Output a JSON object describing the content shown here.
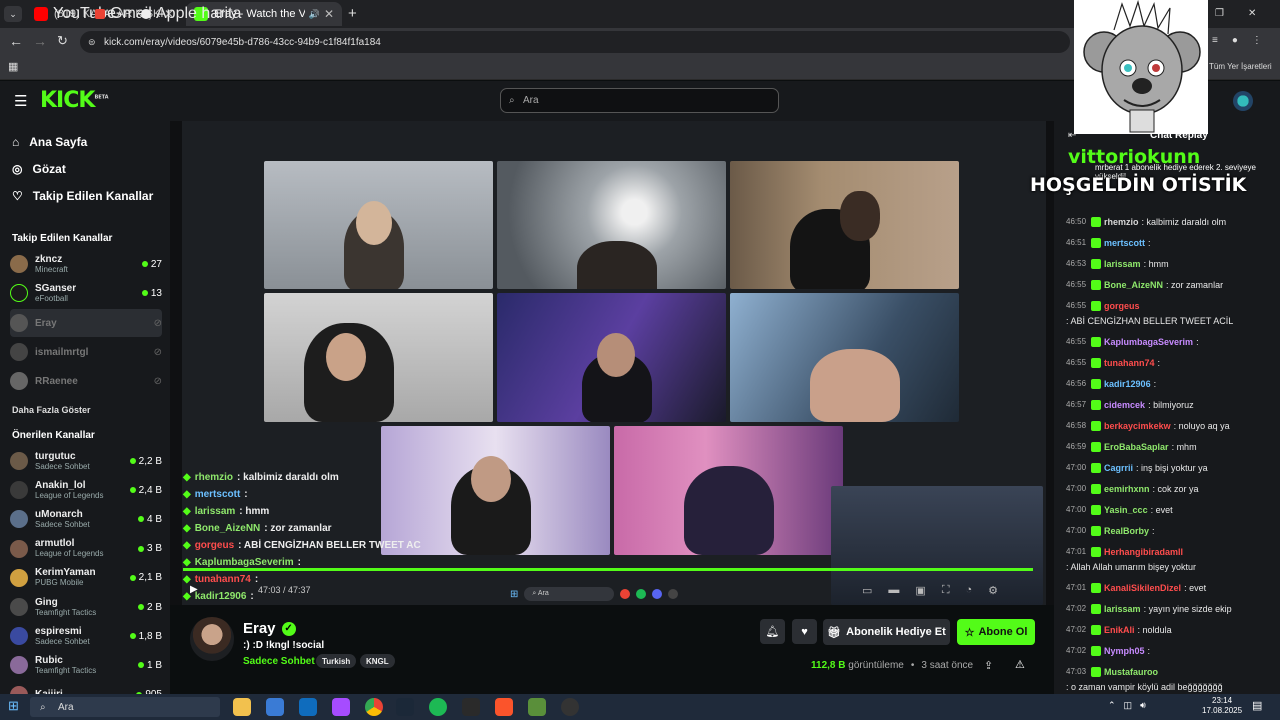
{
  "browser": {
    "tabs": [
      {
        "label": "(819) KAFALAR KIŞKIRTMA - Bİ",
        "icon": "youtube-icon",
        "color": "#ff0000"
      },
      {
        "label": "Eray - Watch the VOD on Ki",
        "icon": "kick-icon",
        "color": "#53fc18"
      }
    ],
    "url": "kick.com/eray/videos/6079e45b-d786-43cc-94b9-c1f84f1fa184",
    "bookmarks": [
      "YouTube",
      "Gmail",
      "Apple harita"
    ],
    "all_bookmarks": "Tüm Yer İşaretleri"
  },
  "kick": {
    "logo": "KICK",
    "logo_badge": "BETA",
    "search_placeholder": "Ara"
  },
  "sidebar": {
    "nav": [
      "Ana Sayfa",
      "Gözat",
      "Takip Edilen Kanallar"
    ],
    "followed_heading": "Takip Edilen Kanallar",
    "followed": [
      {
        "name": "zkncz",
        "game": "Minecraft",
        "viewers": "27",
        "live": true
      },
      {
        "name": "SGanser",
        "game": "eFootball",
        "viewers": "13",
        "live": true
      },
      {
        "name": "Eray",
        "game": "",
        "viewers": "",
        "live": false
      },
      {
        "name": "ismailmrtgl",
        "game": "",
        "viewers": "",
        "live": false
      },
      {
        "name": "RRaenee",
        "game": "",
        "viewers": "",
        "live": false
      }
    ],
    "show_more": "Daha Fazla Göster",
    "recommended_heading": "Önerilen Kanallar",
    "recommended": [
      {
        "name": "turgutuc",
        "game": "Sadece Sohbet",
        "viewers": "2,2 B"
      },
      {
        "name": "Anakin_lol",
        "game": "League of Legends",
        "viewers": "2,4 B"
      },
      {
        "name": "uMonarch",
        "game": "Sadece Sohbet",
        "viewers": "4 B"
      },
      {
        "name": "armutlol",
        "game": "League of Legends",
        "viewers": "3 B"
      },
      {
        "name": "KerimYaman",
        "game": "PUBG Mobile",
        "viewers": "2,1 B"
      },
      {
        "name": "Ging",
        "game": "Teamfight Tactics",
        "viewers": "2 B"
      },
      {
        "name": "espiresmi",
        "game": "Sadece Sohbet",
        "viewers": "1,8 B"
      },
      {
        "name": "Rubic",
        "game": "Teamfight Tactics",
        "viewers": "1 B"
      },
      {
        "name": "Kaiiiri",
        "game": "",
        "viewers": "905"
      }
    ]
  },
  "player": {
    "overlay_chat": [
      {
        "user": "rhemzio",
        "msg": " : kalbimiz daraldı olm",
        "style": ""
      },
      {
        "user": "mertscott",
        "msg": " : ",
        "style": "blue"
      },
      {
        "user": "larissam",
        "msg": " : hmm",
        "style": ""
      },
      {
        "user": "Bone_AizeNN",
        "msg": " : zor zamanlar",
        "style": ""
      },
      {
        "user": "gorgeus",
        "msg": " : ABİ CENGİZHAN BELLER TWEET AC",
        "style": "red"
      },
      {
        "user": "KaplumbagaSeverim",
        "msg": " : ",
        "style": ""
      },
      {
        "user": "tunahann74",
        "msg": " : ",
        "style": "red"
      },
      {
        "user": "kadir12906",
        "msg": " : ",
        "style": ""
      }
    ],
    "time": "47:03 / 47:37",
    "inner_search": "Ara",
    "progress": 0.988
  },
  "channel": {
    "name": "Eray",
    "title": ":) :D !kngl !social",
    "category": "Sadece Sohbet",
    "tags": [
      "Turkish",
      "KNGL"
    ],
    "gift_label": "Abonelik Hediye Et",
    "sub_label": "Abone Ol",
    "views": "112,8 B",
    "views_label": "görüntüleme",
    "ago": "3 saat önce"
  },
  "chat": {
    "header": "Chat Replay",
    "pinned": "mrberat  1 abonelik hediye ederek 2. seviyeye yükseldi!",
    "overlay_name": "vittoriokunn",
    "overlay_text": "HOŞGELDİN OTİSTİK",
    "messages": [
      {
        "time": "46:50",
        "user": "rhemzio",
        "color": "#d7d7d7",
        "msg": ": kalbimiz daraldı olm"
      },
      {
        "time": "46:51",
        "user": "mertscott",
        "color": "#6cc0ff",
        "msg": ":"
      },
      {
        "time": "46:53",
        "user": "larissam",
        "color": "#8fe86c",
        "msg": ": hmm"
      },
      {
        "time": "46:55",
        "user": "Bone_AizeNN",
        "color": "#8fe86c",
        "msg": ": zor zamanlar"
      },
      {
        "time": "46:55",
        "user": "gorgeus",
        "color": "#ff4d4d",
        "msg": ": ABİ CENGİZHAN BELLER TWEET ACİL"
      },
      {
        "time": "46:55",
        "user": "KaplumbagaSeverim",
        "color": "#c78bff",
        "msg": ":"
      },
      {
        "time": "46:55",
        "user": "tunahann74",
        "color": "#ff4d4d",
        "msg": ":"
      },
      {
        "time": "46:56",
        "user": "kadir12906",
        "color": "#6cc0ff",
        "msg": ":"
      },
      {
        "time": "46:57",
        "user": "cidemcek",
        "color": "#c78bff",
        "msg": ": bilmiyoruz"
      },
      {
        "time": "46:58",
        "user": "berkaycimkekw",
        "color": "#ff4d4d",
        "msg": ": noluyo aq ya"
      },
      {
        "time": "46:59",
        "user": "EroBabaSaplar",
        "color": "#8fe86c",
        "msg": ": mhm"
      },
      {
        "time": "47:00",
        "user": "Cagrrii",
        "color": "#6cc0ff",
        "msg": ": inş bişi yoktur ya"
      },
      {
        "time": "47:00",
        "user": "eemirhxnn",
        "color": "#8fe86c",
        "msg": ": cok zor ya"
      },
      {
        "time": "47:00",
        "user": "Yasin_ccc",
        "color": "#8fe86c",
        "msg": ": evet"
      },
      {
        "time": "47:00",
        "user": "RealBorby",
        "color": "#8fe86c",
        "msg": ":"
      },
      {
        "time": "47:01",
        "user": "Herhangibiradamll",
        "color": "#ff4d4d",
        "msg": ": Allah Allah umarım bişey yoktur"
      },
      {
        "time": "47:01",
        "user": "KanaliSikilenDizel",
        "color": "#ff4d4d",
        "msg": ": evet"
      },
      {
        "time": "47:02",
        "user": "larissam",
        "color": "#8fe86c",
        "msg": ": yayın yine sizde ekip"
      },
      {
        "time": "47:02",
        "user": "EnikAli",
        "color": "#ff4d4d",
        "msg": ": noldula"
      },
      {
        "time": "47:02",
        "user": "Nymph05",
        "color": "#c78bff",
        "msg": ":"
      },
      {
        "time": "47:03",
        "user": "Mustafauroo",
        "color": "#8fe86c",
        "msg": ": o zaman vampir köylü adil beğğğğğğğ"
      }
    ]
  },
  "taskbar": {
    "search": "Ara",
    "time": "23:14",
    "date": "17.08.2025"
  }
}
